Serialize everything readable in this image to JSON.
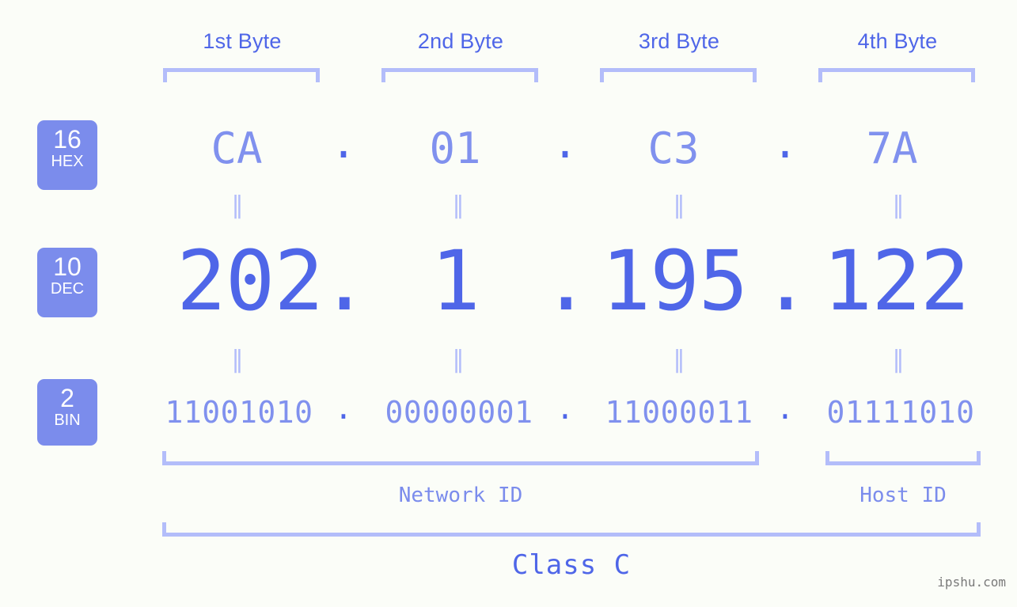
{
  "meta": {
    "background": "#fbfdf8",
    "accent_dark": "#4f66e8",
    "accent_light": "#7b8cec",
    "bracket_color": "#b3bdfa",
    "watermark": "ipshu.com"
  },
  "headers": [
    {
      "label": "1st Byte"
    },
    {
      "label": "2nd Byte"
    },
    {
      "label": "3rd Byte"
    },
    {
      "label": "4th Byte"
    }
  ],
  "bases": [
    {
      "num": "16",
      "name": "HEX"
    },
    {
      "num": "10",
      "name": "DEC"
    },
    {
      "num": "2",
      "name": "BIN"
    }
  ],
  "separator": ".",
  "equals_mark": "‖",
  "rows": {
    "hex": {
      "base": "16",
      "base_name": "HEX",
      "values": [
        "CA",
        "01",
        "C3",
        "7A"
      ]
    },
    "dec": {
      "base": "10",
      "base_name": "DEC",
      "values": [
        "202",
        "1",
        "195",
        "122"
      ]
    },
    "bin": {
      "base": "2",
      "base_name": "BIN",
      "values": [
        "11001010",
        "00000001",
        "11000011",
        "01111010"
      ]
    }
  },
  "ip": {
    "hex": "CA.01.C3.7A",
    "dec": "202.1.195.122",
    "bin": "11001010.00000001.11000011.01111010"
  },
  "segments": {
    "network_id": "Network ID",
    "host_id": "Host ID",
    "class": "Class C"
  }
}
